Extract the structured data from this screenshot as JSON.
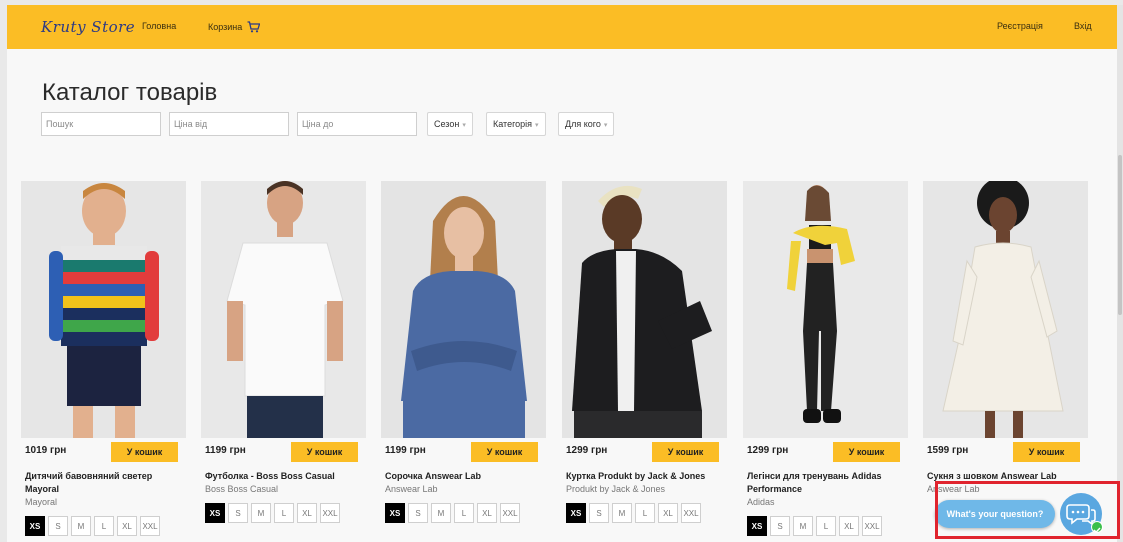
{
  "navbar": {
    "brand": "Kruty Store",
    "home": "Головна",
    "cart": "Корзина",
    "register": "Реєстрація",
    "login": "Вхід"
  },
  "catalog": {
    "title": "Каталог товарів",
    "search_placeholder": "Пошук",
    "price_from_placeholder": "Ціна від",
    "price_to_placeholder": "Ціна до",
    "season": "Сезон",
    "category": "Категорія",
    "for_whom": "Для кого"
  },
  "products": [
    {
      "price": "1019 грн",
      "button": "У кошик",
      "name": "Дитячий бавовняний светер Mayoral",
      "brand": "Mayoral",
      "sizes": [
        "XS",
        "S",
        "M",
        "L",
        "XL",
        "XXL"
      ],
      "selected": "XS"
    },
    {
      "price": "1199 грн",
      "button": "У кошик",
      "name": "Футболка - Boss Boss Casual",
      "brand": "Boss Boss Casual",
      "sizes": [
        "XS",
        "S",
        "M",
        "L",
        "XL",
        "XXL"
      ],
      "selected": "XS"
    },
    {
      "price": "1199 грн",
      "button": "У кошик",
      "name": "Сорочка Answear Lab",
      "brand": "Answear Lab",
      "sizes": [
        "XS",
        "S",
        "M",
        "L",
        "XL",
        "XXL"
      ],
      "selected": "XS"
    },
    {
      "price": "1299 грн",
      "button": "У кошик",
      "name": "Куртка Produkt by Jack & Jones",
      "brand": "Produkt by Jack & Jones",
      "sizes": [
        "XS",
        "S",
        "M",
        "L",
        "XL",
        "XXL"
      ],
      "selected": "XS"
    },
    {
      "price": "1299 грн",
      "button": "У кошик",
      "name": "Легінси для тренувань Adidas Performance",
      "brand": "Adidas",
      "sizes": [
        "XS",
        "S",
        "M",
        "L",
        "XL",
        "XXL"
      ],
      "selected": "XS"
    },
    {
      "price": "1599 грн",
      "button": "У кошик",
      "name": "Сукня з шовком Answear Lab",
      "brand": "Answear Lab",
      "sizes": [],
      "selected": ""
    }
  ],
  "chat": {
    "question": "What's your question?"
  },
  "colors": {
    "accent": "#fbbd25",
    "chat": "#6fb8e8",
    "highlight": "#e0242e"
  }
}
